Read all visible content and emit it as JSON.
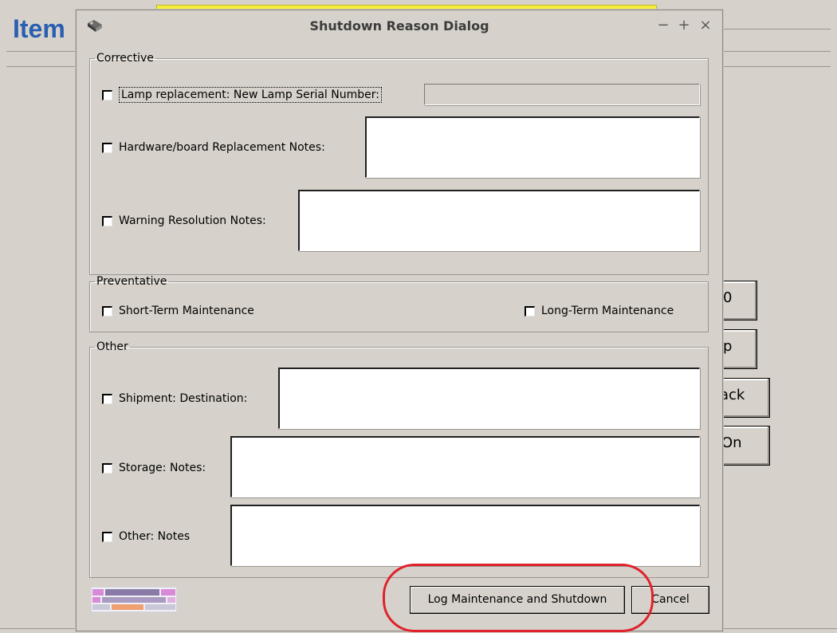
{
  "background": {
    "app_title": "Item",
    "banner_text": "",
    "buttons": [
      {
        "label": "0"
      },
      {
        "label": "p"
      },
      {
        "label": "ack"
      },
      {
        "label": "On"
      }
    ]
  },
  "dialog": {
    "title": "Shutdown Reason Dialog",
    "window_controls": {
      "minimize": "−",
      "maximize": "+",
      "close": "×"
    },
    "corrective": {
      "legend": "Corrective",
      "lamp_label": "Lamp replacement: New Lamp Serial Number:",
      "lamp_value": "",
      "hardware_label": "Hardware/board Replacement Notes:",
      "hardware_value": "",
      "warning_label": "Warning Resolution Notes:",
      "warning_value": ""
    },
    "preventative": {
      "legend": "Preventative",
      "short_label": "Short-Term Maintenance",
      "long_label": "Long-Term Maintenance"
    },
    "other": {
      "legend": "Other",
      "shipment_label": "Shipment: Destination:",
      "shipment_value": "",
      "storage_label": "Storage: Notes:",
      "storage_value": "",
      "other_label": "Other: Notes",
      "other_value": ""
    },
    "buttons": {
      "log_label": "Log Maintenance and Shutdown",
      "cancel_label": "Cancel"
    }
  },
  "colors": {
    "background": "#d6d2cb",
    "title_blue": "#2a5fb0",
    "annotation_red": "#e0212b"
  }
}
